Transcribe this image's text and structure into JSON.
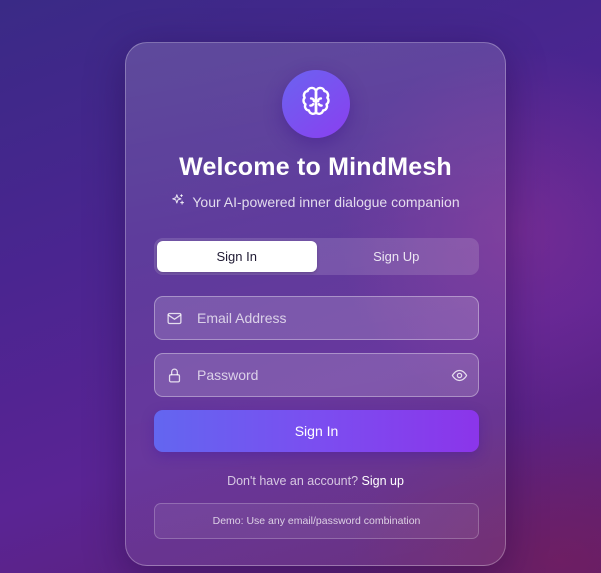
{
  "app": {
    "title": "Welcome to MindMesh",
    "subtitle": "Your AI-powered inner dialogue companion",
    "logo_icon": "brain-icon",
    "subtitle_icon": "sparkles-icon"
  },
  "tabs": [
    {
      "label": "Sign In",
      "active": true
    },
    {
      "label": "Sign Up",
      "active": false
    }
  ],
  "form": {
    "email": {
      "placeholder": "Email Address",
      "value": "",
      "icon": "mail-icon"
    },
    "password": {
      "placeholder": "Password",
      "value": "",
      "icon": "lock-icon",
      "toggle_icon": "eye-icon"
    },
    "submit_label": "Sign In"
  },
  "footer": {
    "prompt": "Don't have an account?",
    "link": "Sign up",
    "demo_note": "Demo: Use any email/password combination"
  },
  "colors": {
    "accent_start": "#6366f0",
    "accent_end": "#8b35ea",
    "background": "#4a2590"
  }
}
